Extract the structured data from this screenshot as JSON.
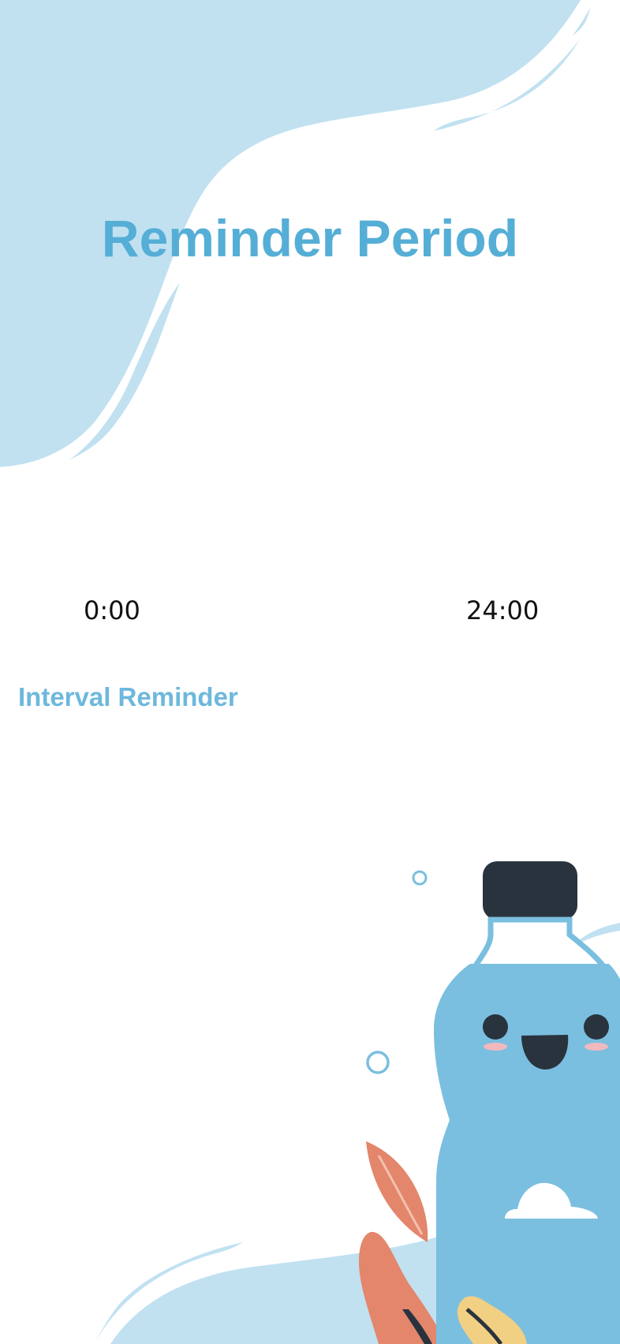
{
  "page": {
    "title": "Reminder Period"
  },
  "period": {
    "start_label": "0:00",
    "end_label": "24:00"
  },
  "interval": {
    "section_title": "Interval Reminder"
  },
  "theme": {
    "accent": "#55aed6",
    "light_blue": "#c1e1f1",
    "bottle_blue": "#7abfdf",
    "dark": "#29333d",
    "leaf_orange": "#e3866c",
    "leaf_yellow": "#f1cf83",
    "background": "#ffffff"
  },
  "decor": {
    "mascot": "water-bottle-mascot-illustration"
  }
}
